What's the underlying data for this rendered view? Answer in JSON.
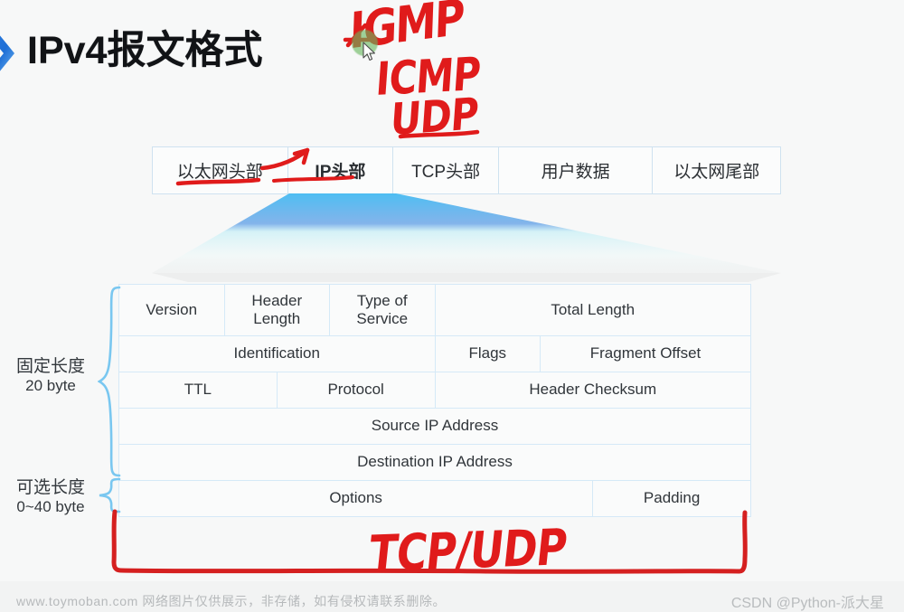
{
  "slide": {
    "title": "IPv4报文格式",
    "logo_icon": "blue-chevron-icon",
    "background_color": "#f7f8f8"
  },
  "packet_strip": {
    "cells": [
      {
        "label": "以太网头部",
        "bold": false,
        "underlined": false
      },
      {
        "label": "IP头部",
        "bold": true,
        "underlined": true
      },
      {
        "label": "TCP头部",
        "bold": false,
        "underlined": true
      },
      {
        "label": "用户数据",
        "bold": false,
        "underlined": false
      },
      {
        "label": "以太网尾部",
        "bold": false,
        "underlined": false
      }
    ],
    "border_color": "#cfe2f0"
  },
  "funnel": {
    "name": "expansion-funnel",
    "colors": [
      "#6fa8e8",
      "#49b7ef",
      "#a8e4f5",
      "#eef6f6"
    ]
  },
  "header_table": {
    "border_color": "#d5e9f7",
    "rows": [
      {
        "name": "row-version",
        "cells": [
          {
            "label": "Version",
            "span": 2
          },
          {
            "label": "Header\nLength",
            "span": 2
          },
          {
            "label": "Type of\nService",
            "span": 2
          },
          {
            "label": "Total Length",
            "span": 6
          }
        ]
      },
      {
        "name": "row-identification",
        "cells": [
          {
            "label": "Identification",
            "span": 6
          },
          {
            "label": "Flags",
            "span": 2
          },
          {
            "label": "Fragment Offset",
            "span": 4
          }
        ]
      },
      {
        "name": "row-ttl",
        "cells": [
          {
            "label": "TTL",
            "span": 3
          },
          {
            "label": "Protocol",
            "span": 3
          },
          {
            "label": "Header Checksum",
            "span": 6
          }
        ]
      },
      {
        "name": "row-source-ip",
        "cells": [
          {
            "label": "Source IP Address",
            "span": 12
          }
        ]
      },
      {
        "name": "row-destination-ip",
        "cells": [
          {
            "label": "Destination IP Address",
            "span": 12
          }
        ]
      },
      {
        "name": "row-options",
        "cells": [
          {
            "label": "Options",
            "span": 9
          },
          {
            "label": "Padding",
            "span": 3
          }
        ]
      }
    ]
  },
  "side_labels": {
    "fixed": {
      "line1": "固定长度",
      "line2": "20 byte",
      "brace_icon": "curly-brace-icon"
    },
    "optional": {
      "line1": "可选长度",
      "line2": "0~40 byte",
      "brace_icon": "curly-brace-icon"
    },
    "brace_color": "#79c7f0"
  },
  "annotations": {
    "ink_color": "#e01b1b",
    "handwriting": [
      {
        "name": "handwriting-igmp",
        "text": "IGMP"
      },
      {
        "name": "handwriting-icmp",
        "text": "ICMP"
      },
      {
        "name": "handwriting-udp",
        "text": "UDP"
      },
      {
        "name": "handwriting-tcp-udp",
        "text": "TCP/UDP"
      }
    ],
    "arrow": "red-curved-arrow-icon",
    "box": "red-hand-drawn-rectangle",
    "cursor": {
      "click_highlight_color": "#68b85e",
      "pointer_icon": "mouse-pointer-icon"
    }
  },
  "watermarks": {
    "left": "www.toymoban.com 网络图片仅供展示，非存储，如有侵权请联系删除。",
    "right": "CSDN @Python-派大星"
  }
}
